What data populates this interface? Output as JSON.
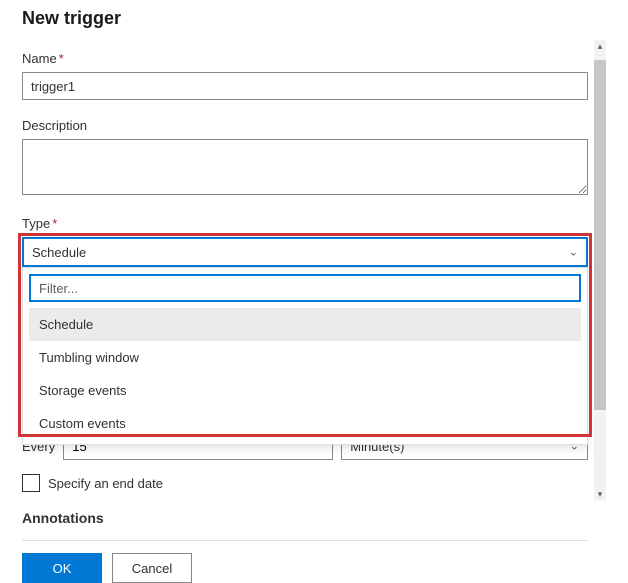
{
  "title": "New trigger",
  "fields": {
    "name_label": "Name",
    "name_value": "trigger1",
    "desc_label": "Description",
    "desc_value": "",
    "type_label": "Type",
    "type_selected": "Schedule",
    "filter_placeholder": "Filter...",
    "type_options": [
      "Schedule",
      "Tumbling window",
      "Storage events",
      "Custom events"
    ]
  },
  "recurrence": {
    "every_label": "Every",
    "every_value": "15",
    "unit_selected": "Minute(s)"
  },
  "end_date_label": "Specify an end date",
  "annotations_label": "Annotations",
  "footer": {
    "ok": "OK",
    "cancel": "Cancel"
  }
}
